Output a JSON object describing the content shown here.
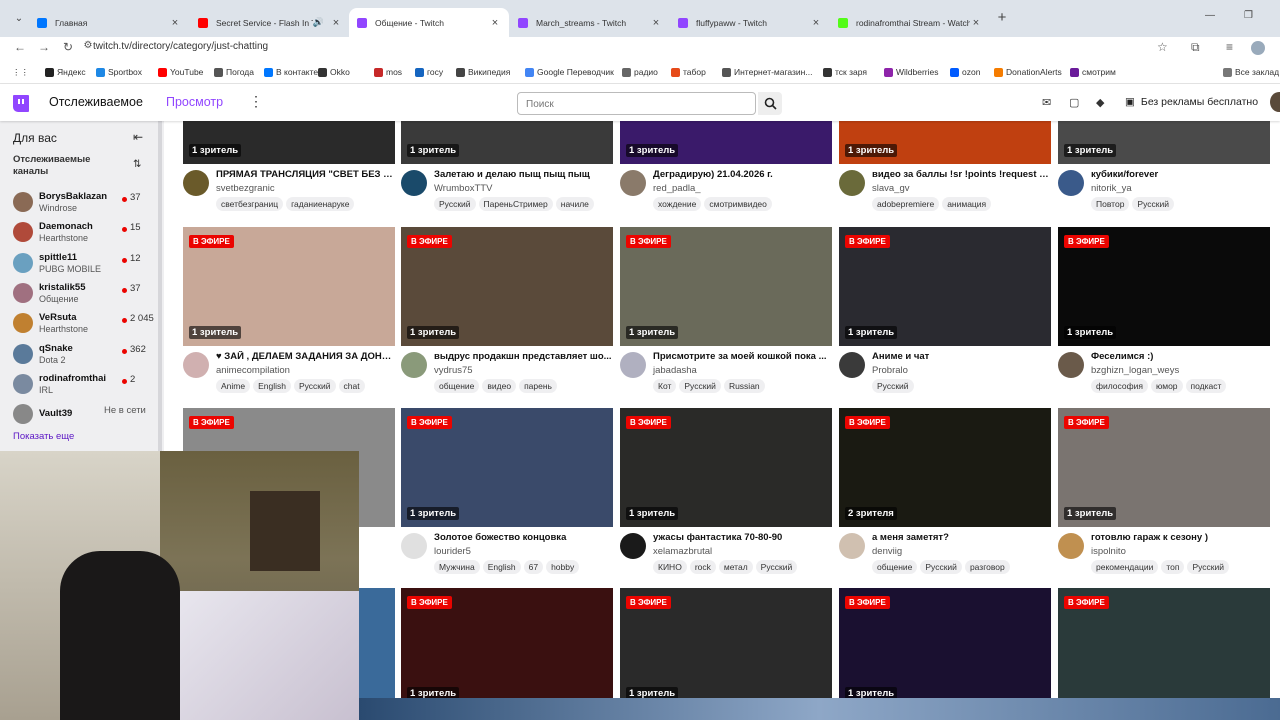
{
  "browser": {
    "tabs": [
      {
        "title": "Главная",
        "color": "#0077ff",
        "active": false
      },
      {
        "title": "Secret Service - Flash In The",
        "color": "#ff0000",
        "active": false
      },
      {
        "title": "Общение - Twitch",
        "color": "#9146ff",
        "active": true
      },
      {
        "title": "March_streams - Twitch",
        "color": "#9146ff",
        "active": false
      },
      {
        "title": "fluffypaww - Twitch",
        "color": "#9146ff",
        "active": false
      },
      {
        "title": "rodinafromthai Stream - Watch",
        "color": "#53fc18",
        "active": false
      }
    ],
    "url": "twitch.tv/directory/category/just-chatting",
    "bookmarks": [
      {
        "label": "Яндекс",
        "color": "#222"
      },
      {
        "label": "Sportbox",
        "color": "#1e88e5"
      },
      {
        "label": "YouTube",
        "color": "#ff0000"
      },
      {
        "label": "Погода",
        "color": "#555"
      },
      {
        "label": "В контакте",
        "color": "#0077ff"
      },
      {
        "label": "Okko",
        "color": "#333"
      },
      {
        "label": "mos",
        "color": "#c62828"
      },
      {
        "label": "госу",
        "color": "#1565c0"
      },
      {
        "label": "Википедия",
        "color": "#444"
      },
      {
        "label": "Google Переводчик",
        "color": "#4285f4"
      },
      {
        "label": "радио",
        "color": "#666"
      },
      {
        "label": "табор",
        "color": "#e64a19"
      },
      {
        "label": "Интернет-магазин...",
        "color": "#555"
      },
      {
        "label": "тск заря",
        "color": "#333"
      },
      {
        "label": "Wildberries",
        "color": "#8e24aa"
      },
      {
        "label": "ozon",
        "color": "#005bff"
      },
      {
        "label": "DonationAlerts",
        "color": "#f57c00"
      },
      {
        "label": "смотрим",
        "color": "#6a1b9a"
      }
    ],
    "all_bookmarks": "Все заклад"
  },
  "header": {
    "following": "Отслеживаемое",
    "browse": "Просмотр",
    "search_placeholder": "Поиск",
    "noads": "Без рекламы бесплатно"
  },
  "sidebar": {
    "title": "Для вас",
    "subtitle": "Отслеживаемые каналы",
    "show_more": "Показать еще",
    "channels": [
      {
        "name": "BorysBaklazan",
        "game": "Windrose",
        "viewers": "37",
        "color": "#8a6a55"
      },
      {
        "name": "Daemonach",
        "game": "Hearthstone",
        "viewers": "15",
        "color": "#b04a3a"
      },
      {
        "name": "spittle11",
        "game": "PUBG MOBILE",
        "viewers": "12",
        "color": "#6aa0c0"
      },
      {
        "name": "kristalik55",
        "game": "Общение",
        "viewers": "37",
        "color": "#a07080"
      },
      {
        "name": "VeRsuta",
        "game": "Hearthstone",
        "viewers": "2 045",
        "color": "#c08030"
      },
      {
        "name": "qSnake",
        "game": "Dota 2",
        "viewers": "362",
        "color": "#5a7a9a"
      },
      {
        "name": "rodinafromthai",
        "game": "IRL",
        "viewers": "2",
        "color": "#7a8aa0"
      },
      {
        "name": "Vault39",
        "game": "",
        "viewers": "",
        "offline": "Не в сети",
        "color": "#888"
      }
    ]
  },
  "streams": [
    {
      "title": "ПРЯМАЯ ТРАНСЛЯЦИЯ \"СВЕТ БЕЗ Г...",
      "name": "svetbezgranic",
      "viewers": "1 зритель",
      "live": "",
      "tags": [
        "светбезграниц",
        "гаданиенаруке"
      ],
      "bg": "#2a2a2a",
      "av": "#6a5a2a"
    },
    {
      "title": "Залетаю и делаю пыщ пыщ пыщ",
      "name": "WrumboxTTV",
      "viewers": "1 зритель",
      "live": "",
      "tags": [
        "Русский",
        "ПареньСтример",
        "начиле"
      ],
      "bg": "#3a3a3a",
      "av": "#1a4a6a"
    },
    {
      "title": "Деградирую) 21.04.2026 г.",
      "name": "red_padla_",
      "viewers": "1 зритель",
      "live": "",
      "tags": [
        "хождение",
        "смотримвидео"
      ],
      "bg": "#3a1a6a",
      "av": "#8a7a6a"
    },
    {
      "title": "видео за баллы !sr !points !request (...",
      "name": "slava_gv",
      "viewers": "1 зритель",
      "live": "",
      "tags": [
        "adobepremiere",
        "анимация"
      ],
      "bg": "#c04010",
      "av": "#6a6a3a"
    },
    {
      "title": "кубики/forever",
      "name": "nitorik_ya",
      "viewers": "1 зритель",
      "live": "",
      "tags": [
        "Повтор",
        "Русский"
      ],
      "bg": "#4a4a4a",
      "av": "#3a5a8a"
    },
    {
      "title": "♥ ЗАЙ , ДЕЛАЕМ ЗАДАНИЯ ЗА ДОНА...",
      "name": "animecompilation",
      "viewers": "1 зритель",
      "live": "В ЭФИРЕ",
      "tags": [
        "Anime",
        "English",
        "Русский",
        "chat"
      ],
      "bg": "#c8a898",
      "av": "#d0b0b0"
    },
    {
      "title": "выдрус продакшн представляет шо...",
      "name": "vydrus75",
      "viewers": "1 зритель",
      "live": "В ЭФИРЕ",
      "tags": [
        "общение",
        "видео",
        "парень"
      ],
      "bg": "#5a4a3a",
      "av": "#8a9a7a"
    },
    {
      "title": "Присмотрите за моей кошкой пока ...",
      "name": "jabadasha",
      "viewers": "1 зритель",
      "live": "В ЭФИРЕ",
      "tags": [
        "Кот",
        "Русский",
        "Russian"
      ],
      "bg": "#6a6a5a",
      "av": "#b0b0c0"
    },
    {
      "title": "Аниме и чат",
      "name": "Probralo",
      "viewers": "1 зритель",
      "live": "В ЭФИРЕ",
      "tags": [
        "Русский"
      ],
      "bg": "#2a2a30",
      "av": "#3a3a3a"
    },
    {
      "title": "Феселимся :)",
      "name": "bzghizn_logan_weys",
      "viewers": "1 зритель",
      "live": "В ЭФИРЕ",
      "tags": [
        "философия",
        "юмор",
        "подкаст"
      ],
      "bg": "#0a0a0a",
      "av": "#6a5a4a"
    },
    {
      "title": "",
      "name": "",
      "viewers": "",
      "live": "В ЭФИРЕ",
      "tags": [],
      "bg": "#8a8a8a",
      "av": "#888"
    },
    {
      "title": "Золотое божество концовка",
      "name": "lourider5",
      "viewers": "1 зритель",
      "live": "В ЭФИРЕ",
      "tags": [
        "Мужчина",
        "English",
        "67",
        "hobby"
      ],
      "bg": "#3a4a6a",
      "av": "#e0e0e0"
    },
    {
      "title": "ужасы фантастика 70-80-90",
      "name": "xelamazbrutal",
      "viewers": "1 зритель",
      "live": "В ЭФИРЕ",
      "tags": [
        "КИНО",
        "rock",
        "метал",
        "Русский"
      ],
      "bg": "#2a2a28",
      "av": "#1a1a1a"
    },
    {
      "title": "а меня заметят?",
      "name": "denviig",
      "viewers": "2 зрителя",
      "live": "В ЭФИРЕ",
      "tags": [
        "общение",
        "Русский",
        "разговор"
      ],
      "bg": "#1a1a12",
      "av": "#d0c0b0"
    },
    {
      "title": "готовлю гараж к сезону )",
      "name": "ispolnito",
      "viewers": "1 зритель",
      "live": "В ЭФИРЕ",
      "tags": [
        "рекомендации",
        "топ",
        "Русский"
      ],
      "bg": "#7a7470",
      "av": "#c09050"
    },
    {
      "title": "",
      "name": "",
      "viewers": "",
      "live": "",
      "tags": [],
      "bg": "#3a6a9a",
      "av": "#888"
    },
    {
      "title": "",
      "name": "",
      "viewers": "1 зритель",
      "live": "В ЭФИРЕ",
      "tags": [],
      "bg": "#3a1010",
      "av": "#888"
    },
    {
      "title": "",
      "name": "",
      "viewers": "1 зритель",
      "live": "В ЭФИРЕ",
      "tags": [],
      "bg": "#2a2a2a",
      "av": "#888"
    },
    {
      "title": "",
      "name": "",
      "viewers": "1 зритель",
      "live": "В ЭФИРЕ",
      "tags": [],
      "bg": "#1a1030",
      "av": "#888"
    },
    {
      "title": "",
      "name": "",
      "viewers": "",
      "live": "В ЭФИРЕ",
      "tags": [],
      "bg": "#2a3a3a",
      "av": "#888"
    }
  ]
}
